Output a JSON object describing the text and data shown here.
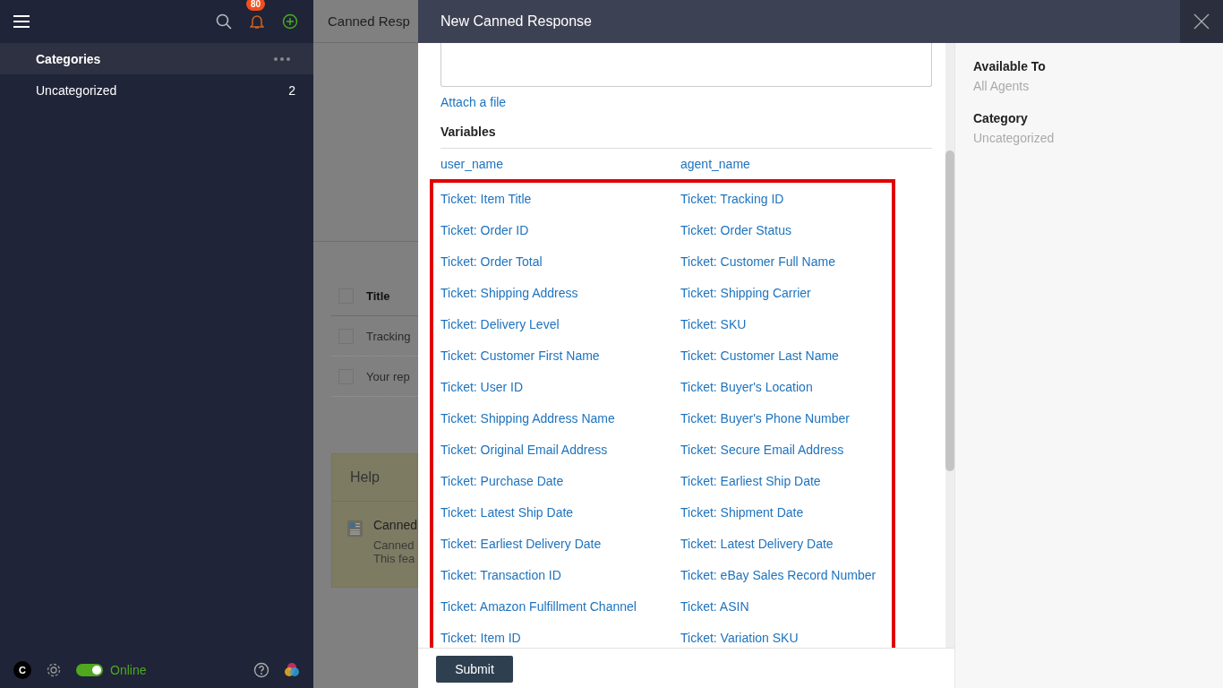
{
  "sidebar": {
    "notification_count": "80",
    "section_title": "Categories",
    "categories": [
      {
        "name": "Uncategorized",
        "count": "2"
      }
    ]
  },
  "status_bar": {
    "avatar_letter": "C",
    "online": true,
    "status_label": "Online"
  },
  "background": {
    "title": "Canned Resp",
    "table_header": {
      "label": "Title",
      "checked": false
    },
    "rows": [
      {
        "label": "Tracking",
        "checked": false
      },
      {
        "label": "Your rep",
        "checked": false
      }
    ],
    "help": {
      "title": "Help",
      "item_title": "Canned",
      "item_lines": [
        "Canned",
        "This fea"
      ]
    }
  },
  "modal": {
    "title": "New Canned Response",
    "attach_link": "Attach a file",
    "variables_title": "Variables",
    "variables": [
      [
        "user_name",
        "agent_name"
      ]
    ],
    "highlighted_variables": [
      [
        "Ticket: Item Title",
        "Ticket: Tracking ID"
      ],
      [
        "Ticket: Order ID",
        "Ticket: Order Status"
      ],
      [
        "Ticket: Order Total",
        "Ticket: Customer Full Name"
      ],
      [
        "Ticket: Shipping Address",
        "Ticket: Shipping Carrier"
      ],
      [
        "Ticket: Delivery Level",
        "Ticket: SKU"
      ],
      [
        "Ticket: Customer First Name",
        "Ticket: Customer Last Name"
      ],
      [
        "Ticket: User ID",
        "Ticket: Buyer's Location"
      ],
      [
        "Ticket: Shipping Address Name",
        "Ticket: Buyer's Phone Number"
      ],
      [
        "Ticket: Original Email Address",
        "Ticket: Secure Email Address"
      ],
      [
        "Ticket: Purchase Date",
        "Ticket: Earliest Ship Date"
      ],
      [
        "Ticket: Latest Ship Date",
        "Ticket: Shipment Date"
      ],
      [
        "Ticket: Earliest Delivery Date",
        "Ticket: Latest Delivery Date"
      ],
      [
        "Ticket: Transaction ID",
        "Ticket: eBay Sales Record Number"
      ],
      [
        "Ticket: Amazon Fulfillment Channel",
        "Ticket: ASIN"
      ],
      [
        "Ticket: Item ID",
        "Ticket: Variation SKU"
      ]
    ],
    "submit_button": "Submit",
    "details": [
      {
        "label": "Available To",
        "value": "All Agents"
      },
      {
        "label": "Category",
        "value": "Uncategorized"
      }
    ]
  }
}
